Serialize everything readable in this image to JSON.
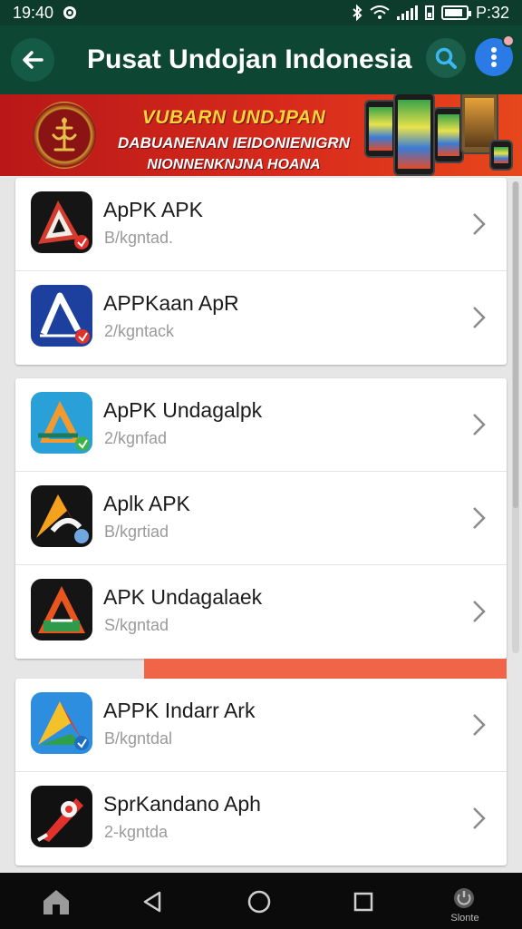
{
  "status_bar": {
    "time_left": "19:40",
    "time_right": "P:32",
    "icons": [
      "whatsapp-icon",
      "bluetooth-icon",
      "wifi-icon",
      "signal-icon",
      "sim-icon",
      "battery-icon"
    ],
    "battery_level": 0.85
  },
  "app_bar": {
    "title": "Pusat Undojan Indonesia",
    "back_icon": "arrow-left-icon",
    "search_icon": "search-icon",
    "menu_icon": "more-vertical-icon",
    "colors": {
      "background": "#0e4634",
      "menu_button": "#2a7be6"
    }
  },
  "banner": {
    "line1": "VUBARN UNDJPAN",
    "line2": "DABUANENAN IEIDONIENIGRN",
    "line3": "NIONNENKNJNA HOANA",
    "colors": {
      "background": "#d72a1c",
      "headline": "#ffd43a"
    }
  },
  "sections": [
    {
      "items": [
        {
          "name": "ApPK APK",
          "subtitle": "B/kgntad.",
          "icon": "apk-logo-dark-red"
        },
        {
          "name": "APPKaan ApR",
          "subtitle": "2/kgntack",
          "icon": "apk-logo-blue"
        }
      ]
    },
    {
      "items": [
        {
          "name": "ApPK Undagalpk",
          "subtitle": "2/kgnfad",
          "icon": "apk-logo-teal-orange"
        },
        {
          "name": "Aplk APK",
          "subtitle": "B/kgrtiad",
          "icon": "apk-logo-black-orange"
        },
        {
          "name": "APK Undagalaek",
          "subtitle": "S/kgntad",
          "icon": "apk-logo-black-green"
        }
      ]
    },
    {
      "items": [
        {
          "name": "APPK Indarr Ark",
          "subtitle": "B/kgntdal",
          "icon": "apk-logo-blue-green"
        },
        {
          "name": "SprKandano Aph",
          "subtitle": "2-kgntda",
          "icon": "apk-logo-black-red"
        }
      ]
    }
  ],
  "nav_bar": {
    "home_icon": "home-icon",
    "back_icon": "triangle-back-icon",
    "home_circle_icon": "circle-home-icon",
    "recents_icon": "square-recents-icon",
    "extra_label": "Slonte"
  }
}
